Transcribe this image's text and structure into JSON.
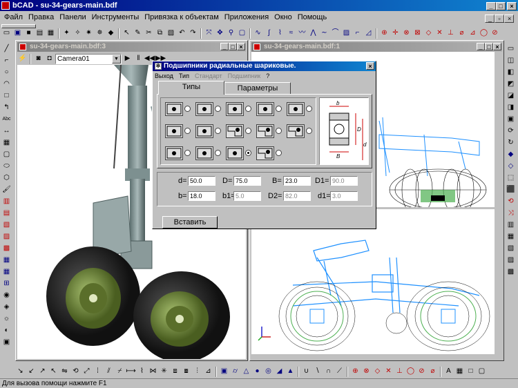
{
  "app": {
    "title": "bCAD - su-34-gears-main.bdf",
    "menu": [
      "Файл",
      "Правка",
      "Панели",
      "Инструменты",
      "Привязка к объектам",
      "Приложения",
      "Окно",
      "Помощь"
    ]
  },
  "left_window": {
    "title": "su-34-gears-main.bdf:3",
    "camera": "Camera01"
  },
  "right_window": {
    "title": "su-34-gears-main.bdf:1"
  },
  "dialog": {
    "title": "Подшипники радиальные шариковые.",
    "menu": [
      "Выход",
      "Тип",
      "Стандарт",
      "Подшипник",
      "?"
    ],
    "tabs": [
      "Типы",
      "Параметры"
    ],
    "params": [
      {
        "label": "d=",
        "value": "50.0",
        "enabled": true
      },
      {
        "label": "D=",
        "value": "75.0",
        "enabled": true
      },
      {
        "label": "B=",
        "value": "23.0",
        "enabled": true
      },
      {
        "label": "D1=",
        "value": "90.0",
        "enabled": false
      },
      {
        "label": "b=",
        "value": "18.0",
        "enabled": true
      },
      {
        "label": "b1=",
        "value": "5.0",
        "enabled": false
      },
      {
        "label": "D2=",
        "value": "82.0",
        "enabled": false
      },
      {
        "label": "d1=",
        "value": "3.0",
        "enabled": false
      }
    ],
    "insert_label": "Вставить",
    "diagram_labels": {
      "b": "b",
      "B": "B",
      "D": "D",
      "d": "d"
    }
  },
  "statusbar": {
    "text": "Для вызова помощи нажмите F1"
  },
  "icons": {
    "app": "bcad-app-icon",
    "close": "close-icon",
    "min": "minimize-icon",
    "max": "maximize-icon"
  },
  "colors": {
    "titlebar": "#000080",
    "face": "#c0c0c0",
    "wire_blue": "#1e90ff",
    "wire_green": "#4caf50"
  }
}
